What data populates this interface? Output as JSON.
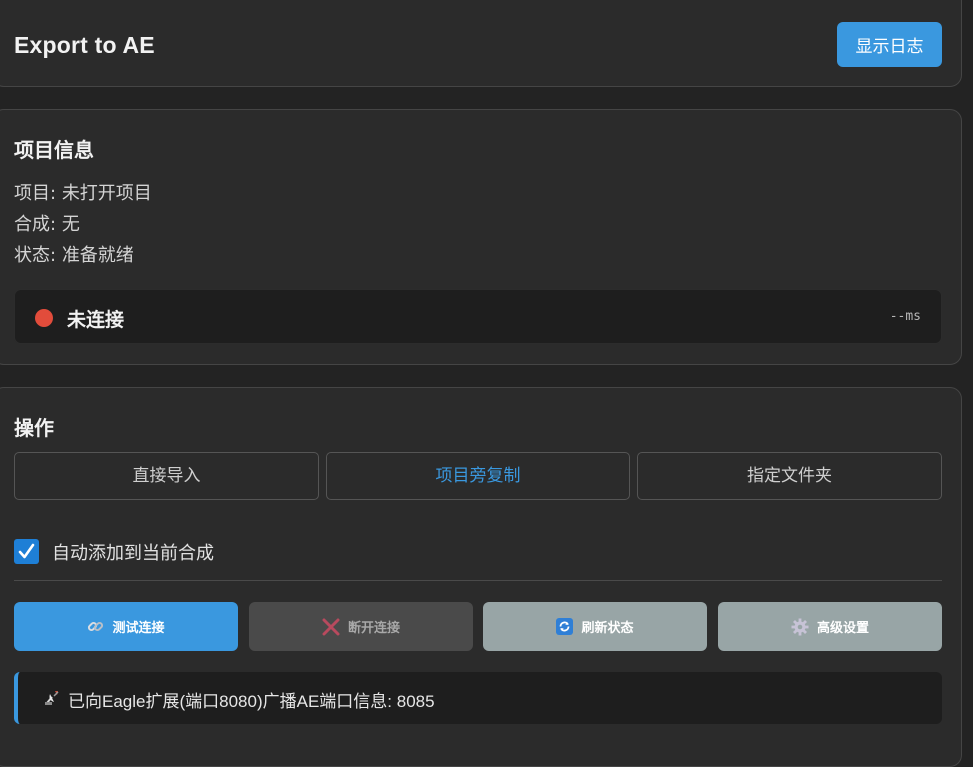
{
  "header": {
    "title": "Export to AE",
    "log_button_label": "显示日志"
  },
  "project_info": {
    "title": "项目信息",
    "project_label": "项目:",
    "project_value": "未打开项目",
    "comp_label": "合成:",
    "comp_value": "无",
    "status_label": "状态:",
    "status_value": "准备就绪",
    "connection": {
      "status_text": "未连接",
      "latency": "--ms",
      "dot_color": "#e24c3b"
    }
  },
  "operations": {
    "title": "操作",
    "modes": [
      {
        "label": "直接导入",
        "active": false
      },
      {
        "label": "项目旁复制",
        "active": true
      },
      {
        "label": "指定文件夹",
        "active": false
      }
    ],
    "auto_add": {
      "label": "自动添加到当前合成",
      "checked": true
    },
    "actions": [
      {
        "label": "测试连接",
        "icon": "link-icon"
      },
      {
        "label": "断开连接",
        "icon": "cross-icon"
      },
      {
        "label": "刷新状态",
        "icon": "refresh-icon"
      },
      {
        "label": "高级设置",
        "icon": "gear-icon"
      }
    ],
    "log_message": {
      "icon": "satellite-antenna-icon",
      "text": "已向Eagle扩展(端口8080)广播AE端口信息: 8085"
    }
  },
  "colors": {
    "accent": "#3a98df",
    "background": "#232323",
    "panel": "#2b2b2b",
    "status_disconnected": "#e24c3b"
  }
}
